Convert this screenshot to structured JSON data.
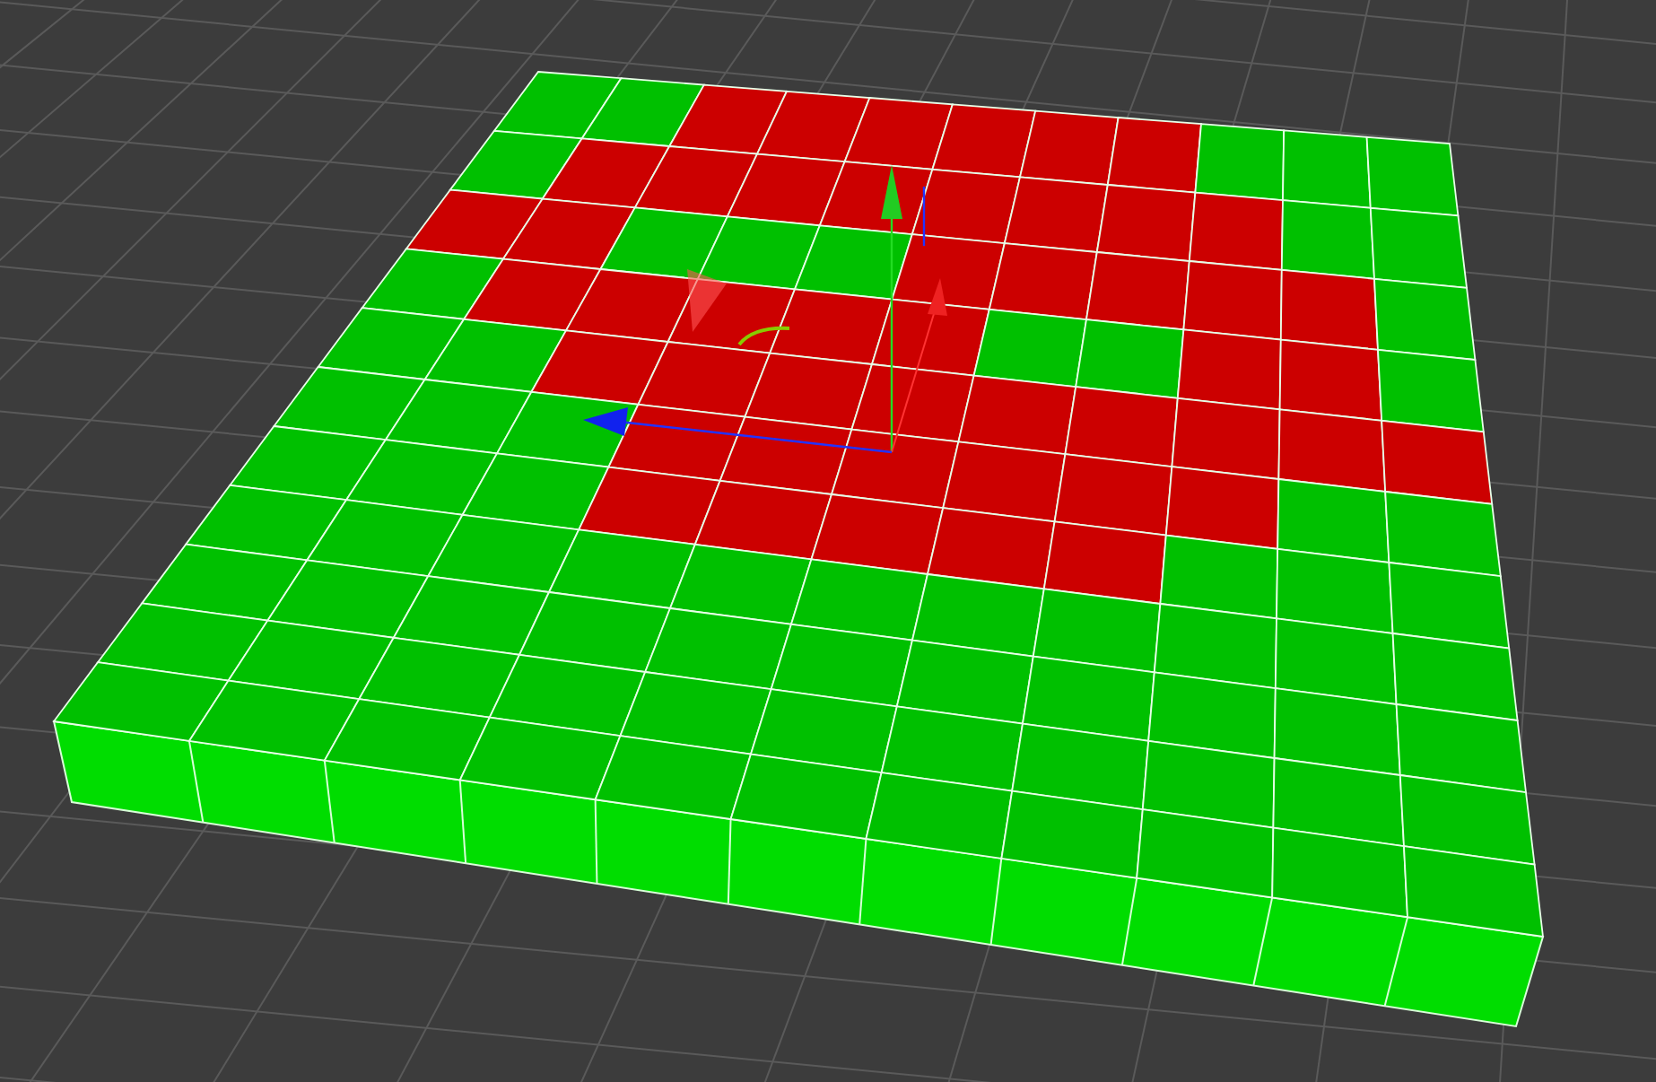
{
  "viewport": {
    "slab": {
      "rows": [
        {
          "cells": [
            {
              "color": "#00c000"
            },
            {
              "color": "#00c000"
            },
            {
              "color": "#cc0000"
            },
            {
              "color": "#cc0000"
            },
            {
              "color": "#cc0000"
            },
            {
              "color": "#cc0000"
            },
            {
              "color": "#cc0000"
            },
            {
              "color": "#cc0000"
            },
            {
              "color": "#00c000"
            },
            {
              "color": "#00c000"
            },
            {
              "color": "#00c000"
            }
          ]
        },
        {
          "cells": [
            {
              "color": "#00c000"
            },
            {
              "color": "#cc0000"
            },
            {
              "color": "#cc0000"
            },
            {
              "color": "#cc0000"
            },
            {
              "color": "#cc0000"
            },
            {
              "color": "#cc0000"
            },
            {
              "color": "#cc0000"
            },
            {
              "color": "#cc0000"
            },
            {
              "color": "#cc0000"
            },
            {
              "color": "#00c000"
            },
            {
              "color": "#00c000"
            }
          ]
        },
        {
          "cells": [
            {
              "color": "#cc0000"
            },
            {
              "color": "#cc0000"
            },
            {
              "color": "#00c000"
            },
            {
              "color": "#00c000"
            },
            {
              "color": "#00c000"
            },
            {
              "color": "#cc0000"
            },
            {
              "color": "#cc0000"
            },
            {
              "color": "#cc0000"
            },
            {
              "color": "#cc0000"
            },
            {
              "color": "#cc0000"
            },
            {
              "color": "#00c000"
            }
          ]
        },
        {
          "cells": [
            {
              "color": "#00c000"
            },
            {
              "color": "#cc0000"
            },
            {
              "color": "#cc0000"
            },
            {
              "color": "#cc0000"
            },
            {
              "color": "#cc0000"
            },
            {
              "color": "#cc0000"
            },
            {
              "color": "#00c000"
            },
            {
              "color": "#00c000"
            },
            {
              "color": "#cc0000"
            },
            {
              "color": "#cc0000"
            },
            {
              "color": "#00c000"
            }
          ]
        },
        {
          "cells": [
            {
              "color": "#00c000"
            },
            {
              "color": "#00c000"
            },
            {
              "color": "#cc0000"
            },
            {
              "color": "#cc0000"
            },
            {
              "color": "#cc0000"
            },
            {
              "color": "#cc0000"
            },
            {
              "color": "#cc0000"
            },
            {
              "color": "#cc0000"
            },
            {
              "color": "#cc0000"
            },
            {
              "color": "#cc0000"
            },
            {
              "color": "#cc0000"
            }
          ]
        },
        {
          "cells": [
            {
              "color": "#00c000"
            },
            {
              "color": "#00c000"
            },
            {
              "color": "#00c000"
            },
            {
              "color": "#cc0000"
            },
            {
              "color": "#cc0000"
            },
            {
              "color": "#cc0000"
            },
            {
              "color": "#cc0000"
            },
            {
              "color": "#cc0000"
            },
            {
              "color": "#cc0000"
            },
            {
              "color": "#00c000"
            },
            {
              "color": "#00c000"
            }
          ]
        },
        {
          "cells": [
            {
              "color": "#00c000"
            },
            {
              "color": "#00c000"
            },
            {
              "color": "#00c000"
            },
            {
              "color": "#cc0000"
            },
            {
              "color": "#cc0000"
            },
            {
              "color": "#cc0000"
            },
            {
              "color": "#cc0000"
            },
            {
              "color": "#cc0000"
            },
            {
              "color": "#00c000"
            },
            {
              "color": "#00c000"
            },
            {
              "color": "#00c000"
            }
          ]
        },
        {
          "cells": [
            {
              "color": "#00c000"
            },
            {
              "color": "#00c000"
            },
            {
              "color": "#00c000"
            },
            {
              "color": "#00c000"
            },
            {
              "color": "#00c000"
            },
            {
              "color": "#00c000"
            },
            {
              "color": "#00c000"
            },
            {
              "color": "#00c000"
            },
            {
              "color": "#00c000"
            },
            {
              "color": "#00c000"
            },
            {
              "color": "#00c000"
            }
          ]
        },
        {
          "cells": [
            {
              "color": "#00c000"
            },
            {
              "color": "#00c000"
            },
            {
              "color": "#00c000"
            },
            {
              "color": "#00c000"
            },
            {
              "color": "#00c000"
            },
            {
              "color": "#00c000"
            },
            {
              "color": "#00c000"
            },
            {
              "color": "#00c000"
            },
            {
              "color": "#00c000"
            },
            {
              "color": "#00c000"
            },
            {
              "color": "#00c000"
            }
          ]
        },
        {
          "cells": [
            {
              "color": "#00c000"
            },
            {
              "color": "#00c000"
            },
            {
              "color": "#00c000"
            },
            {
              "color": "#00c000"
            },
            {
              "color": "#00c000"
            },
            {
              "color": "#00c000"
            },
            {
              "color": "#00c000"
            },
            {
              "color": "#00c000"
            },
            {
              "color": "#00c000"
            },
            {
              "color": "#00c000"
            },
            {
              "color": "#00c000"
            }
          ]
        },
        {
          "cells": [
            {
              "color": "#00c000"
            },
            {
              "color": "#00c000"
            },
            {
              "color": "#00c000"
            },
            {
              "color": "#00c000"
            },
            {
              "color": "#00c000"
            },
            {
              "color": "#00c000"
            },
            {
              "color": "#00c000"
            },
            {
              "color": "#00c000"
            },
            {
              "color": "#00c000"
            },
            {
              "color": "#00c000"
            },
            {
              "color": "#00c000"
            }
          ]
        }
      ]
    }
  }
}
